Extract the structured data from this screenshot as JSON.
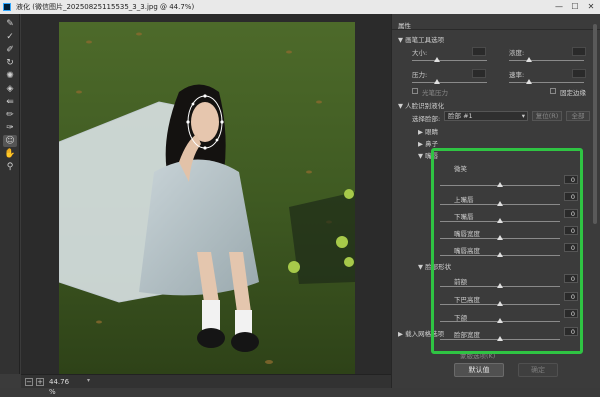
{
  "window": {
    "title": "液化 (微信图片_20250825115535_3_3.jpg @ 44.7%)",
    "min_glyph": "—",
    "max_glyph": "☐",
    "close_glyph": "✕"
  },
  "toolbar": {
    "tools": [
      {
        "icon": "forward-warp-icon",
        "glyph": "✎"
      },
      {
        "icon": "reconstruct-icon",
        "glyph": "✓"
      },
      {
        "icon": "smooth-icon",
        "glyph": "✐"
      },
      {
        "icon": "twirl-icon",
        "glyph": "↻"
      },
      {
        "icon": "pucker-icon",
        "glyph": "✺"
      },
      {
        "icon": "bloat-icon",
        "glyph": "◈"
      },
      {
        "icon": "push-left-icon",
        "glyph": "⇚"
      },
      {
        "icon": "freeze-mask-icon",
        "glyph": "✏"
      },
      {
        "icon": "thaw-mask-icon",
        "glyph": "✑"
      },
      {
        "icon": "face-tool-icon",
        "glyph": "☺"
      },
      {
        "icon": "hand-icon",
        "glyph": "✋"
      },
      {
        "icon": "zoom-icon",
        "glyph": "⚲"
      }
    ]
  },
  "status": {
    "zoom": "44.76",
    "zoom_unit": "%",
    "minus": "−",
    "plus": "+",
    "dropdown": "▾"
  },
  "panel": {
    "title": "属性",
    "brush_section": "画笔工具选项",
    "size_label": "大小:",
    "density_label": "浓度:",
    "pressure_label": "压力:",
    "rate_label": "速率:",
    "stylus_label": "光笔压力",
    "pin_edges_label": "固定边缘",
    "face_section": "人脸识别液化",
    "select_face_label": "选择脸部:",
    "select_face_value": "脸部 #1",
    "reset_label": "复位(R)",
    "all_label": "全部",
    "eyes_label": "眼睛",
    "nose_label": "鼻子",
    "mouth_label": "嘴唇",
    "mouth_items": [
      {
        "label": "微笑",
        "value": "0"
      },
      {
        "label": "上嘴唇",
        "value": "0"
      },
      {
        "label": "下嘴唇",
        "value": "0"
      },
      {
        "label": "嘴唇宽度",
        "value": "0"
      },
      {
        "label": "嘴唇高度",
        "value": "0"
      }
    ],
    "face_shape_label": "脸部形状",
    "face_items": [
      {
        "label": "前额",
        "value": "0"
      },
      {
        "label": "下巴高度",
        "value": "0"
      },
      {
        "label": "下颌",
        "value": "0"
      },
      {
        "label": "脸部宽度",
        "value": "0"
      }
    ],
    "load_mesh_label": "载入网格选项",
    "mask_label": "蒙版选项(K)",
    "default_button": "默认值",
    "ok_button": "确定"
  },
  "colors": {
    "highlight_border": "#2fc443"
  }
}
